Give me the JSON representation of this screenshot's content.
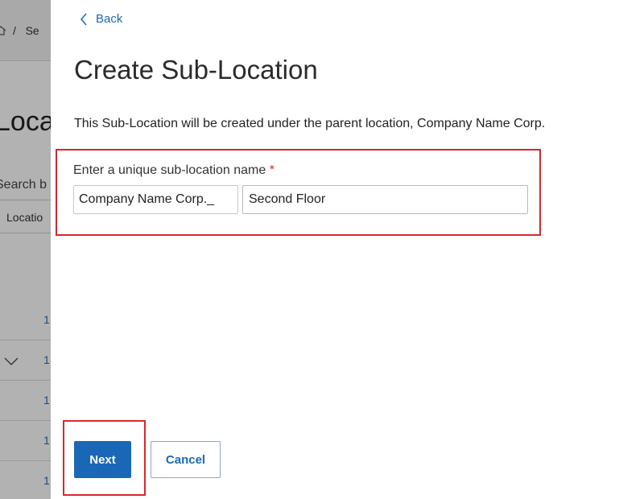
{
  "background": {
    "breadcrumb_separator": "/",
    "breadcrumb_fragment": "Se",
    "title_fragment": "Loca",
    "search_label_fragment": "Search b",
    "column_header_fragment": "Locatio",
    "row_values": [
      "1",
      "1",
      "1",
      "1",
      "1"
    ]
  },
  "panel": {
    "back_label": "Back",
    "title": "Create Sub-Location",
    "description": "This Sub-Location will be created under the parent location, Company Name Corp.",
    "field": {
      "label": "Enter a unique sub-location name",
      "required_marker": "*",
      "prefix": "Company Name Corp._",
      "value": "Second Floor"
    },
    "actions": {
      "next_label": "Next",
      "cancel_label": "Cancel"
    }
  },
  "colors": {
    "accent": "#1a67b8",
    "highlight": "#d9262b"
  }
}
